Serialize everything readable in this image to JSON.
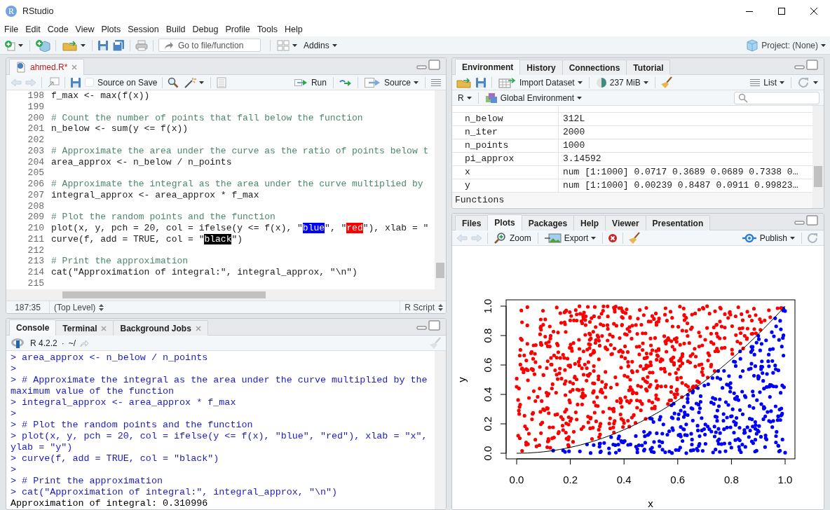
{
  "window": {
    "title": "RStudio",
    "logo_letter": "R"
  },
  "menu": [
    "File",
    "Edit",
    "Code",
    "View",
    "Plots",
    "Session",
    "Build",
    "Debug",
    "Profile",
    "Tools",
    "Help"
  ],
  "main_toolbar": {
    "goto_placeholder": "Go to file/function",
    "addins": "Addins",
    "project": "Project: (None)"
  },
  "editor": {
    "tabs": [
      {
        "label": "ahmed.R*",
        "selected": true,
        "modified": true
      }
    ],
    "source_on_save": {
      "label": "Source on Save",
      "checked": false
    },
    "run": "Run",
    "source": "Source",
    "lines": [
      {
        "number": "198",
        "segments": [
          {
            "kind": "code",
            "text": "f_max <- max(f(x))"
          }
        ]
      },
      {
        "number": "199"
      },
      {
        "number": "200",
        "segments": [
          {
            "kind": "comment",
            "text": "# Count the number of points that fall below the function"
          }
        ]
      },
      {
        "number": "201",
        "segments": [
          {
            "kind": "code",
            "text": "n_below <- sum(y <= f(x))"
          }
        ]
      },
      {
        "number": "202"
      },
      {
        "number": "203",
        "segments": [
          {
            "kind": "comment",
            "text": "# Approximate the area under the curve as the ratio of points below t"
          }
        ]
      },
      {
        "number": "204",
        "segments": [
          {
            "kind": "code",
            "text": "area_approx <- n_below / n_points"
          }
        ]
      },
      {
        "number": "205"
      },
      {
        "number": "206",
        "segments": [
          {
            "kind": "comment",
            "text": "# Approximate the integral as the area under the curve multiplied by"
          }
        ]
      },
      {
        "number": "207",
        "segments": [
          {
            "kind": "code",
            "text": "integral_approx <- area_approx * f_max"
          }
        ]
      },
      {
        "number": "208"
      },
      {
        "number": "209",
        "segments": [
          {
            "kind": "comment",
            "text": "# Plot the random points and the function"
          }
        ]
      },
      {
        "number": "210",
        "segments": [
          {
            "kind": "code",
            "text": "plot(x, y, pch = 20, col = ifelse(y <= f(x), \""
          },
          {
            "kind": "swatch",
            "text": "blue",
            "color": "#0000ff"
          },
          {
            "kind": "code",
            "text": "\", \""
          },
          {
            "kind": "swatch",
            "text": "red",
            "color": "#ff0000"
          },
          {
            "kind": "code",
            "text": "\"), xlab = \""
          }
        ]
      },
      {
        "number": "211",
        "segments": [
          {
            "kind": "code",
            "text": "curve(f, add = TRUE, col = \""
          },
          {
            "kind": "swatch",
            "text": "black",
            "color": "#000000"
          },
          {
            "kind": "code",
            "text": "\")"
          }
        ]
      },
      {
        "number": "212"
      },
      {
        "number": "213",
        "segments": [
          {
            "kind": "comment",
            "text": "# Print the approximation"
          }
        ]
      },
      {
        "number": "214",
        "segments": [
          {
            "kind": "code",
            "text": "cat(\"Approximation of integral:\", integral_approx, \"\\n\")"
          }
        ]
      },
      {
        "number": "215"
      }
    ],
    "status": {
      "position": "187:35",
      "scope": "(Top Level)",
      "file_type": "R Script"
    }
  },
  "console": {
    "tabs": [
      {
        "label": "Console",
        "selected": true,
        "closable": false
      },
      {
        "label": "Terminal",
        "selected": false,
        "closable": true
      },
      {
        "label": "Background Jobs",
        "selected": false,
        "closable": true
      }
    ],
    "version": "R 4.2.2",
    "separator": "·",
    "path": "~/",
    "lines": [
      {
        "kind": "input",
        "text": "> area_approx <- n_below / n_points"
      },
      {
        "kind": "input",
        "text": ">"
      },
      {
        "kind": "input",
        "text": "> # Approximate the integral as the area under the curve multiplied by the"
      },
      {
        "kind": "input",
        "text": "maximum value of the function"
      },
      {
        "kind": "input",
        "text": "> integral_approx <- area_approx * f_max"
      },
      {
        "kind": "input",
        "text": ">"
      },
      {
        "kind": "input",
        "text": "> # Plot the random points and the function"
      },
      {
        "kind": "input",
        "text": "> plot(x, y, pch = 20, col = ifelse(y <= f(x), \"blue\", \"red\"), xlab = \"x\","
      },
      {
        "kind": "input",
        "text": "ylab = \"y\")"
      },
      {
        "kind": "input",
        "text": "> curve(f, add = TRUE, col = \"black\")"
      },
      {
        "kind": "input",
        "text": ">"
      },
      {
        "kind": "input",
        "text": "> # Print the approximation"
      },
      {
        "kind": "input",
        "text": "> cat(\"Approximation of integral:\", integral_approx, \"\\n\")"
      },
      {
        "kind": "output",
        "text": "Approximation of integral: 0.310996"
      }
    ]
  },
  "environment": {
    "tabs": [
      {
        "label": "Environment",
        "selected": true
      },
      {
        "label": "History",
        "selected": false
      },
      {
        "label": "Connections",
        "selected": false
      },
      {
        "label": "Tutorial",
        "selected": false
      }
    ],
    "import": "Import Dataset",
    "memory": "237 MiB",
    "view": "List",
    "language": "R",
    "scope": "Global Environment",
    "rows": [
      {
        "name": "n_below",
        "value": "312L"
      },
      {
        "name": "n_iter",
        "value": "2000"
      },
      {
        "name": "n_points",
        "value": "1000"
      },
      {
        "name": "pi_approx",
        "value": "3.14592"
      },
      {
        "name": "x",
        "value": "num [1:1000] 0.0717 0.3689 0.0689 0.7338 0…"
      },
      {
        "name": "y",
        "value": "num [1:1000] 0.00239 0.8487 0.0911 0.99823…"
      }
    ],
    "section": "Functions"
  },
  "viewer": {
    "tabs": [
      {
        "label": "Files",
        "selected": false
      },
      {
        "label": "Plots",
        "selected": true
      },
      {
        "label": "Packages",
        "selected": false
      },
      {
        "label": "Help",
        "selected": false
      },
      {
        "label": "Viewer",
        "selected": false
      },
      {
        "label": "Presentation",
        "selected": false
      }
    ],
    "zoom": "Zoom",
    "export": "Export",
    "publish": "Publish",
    "plot": {
      "xlabel": "x",
      "ylabel": "y",
      "xticks": [
        "0.0",
        "0.2",
        "0.4",
        "0.6",
        "0.8",
        "1.0"
      ],
      "yticks": [
        "0.0",
        "0.2",
        "0.4",
        "0.6",
        "0.8",
        "1.0"
      ],
      "point_groups": [
        {
          "kind": "below",
          "color": "#0000ff"
        },
        {
          "kind": "above",
          "color": "#ff0000"
        }
      ]
    }
  }
}
